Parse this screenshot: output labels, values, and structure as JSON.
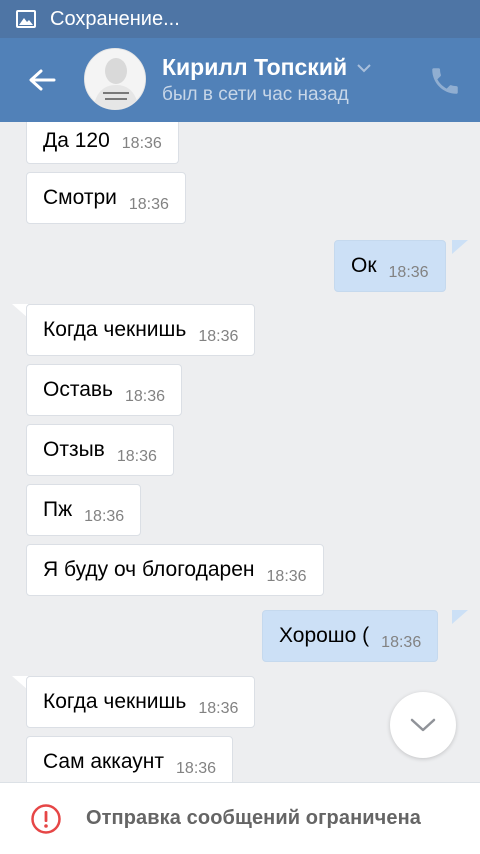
{
  "statusbar": {
    "text": "Сохранение..."
  },
  "header": {
    "name": "Кирилл Топский",
    "status": "был в сети час назад"
  },
  "messages": [
    {
      "text": "Да 120",
      "time": "18:36",
      "dir": "in"
    },
    {
      "text": "Смотри",
      "time": "18:36",
      "dir": "in"
    },
    {
      "text": "Ок",
      "time": "18:36",
      "dir": "out"
    },
    {
      "text": "Когда чекнишь",
      "time": "18:36",
      "dir": "in"
    },
    {
      "text": "Оставь",
      "time": "18:36",
      "dir": "in"
    },
    {
      "text": "Отзыв",
      "time": "18:36",
      "dir": "in"
    },
    {
      "text": "Пж",
      "time": "18:36",
      "dir": "in"
    },
    {
      "text": "Я буду оч блогодарен",
      "time": "18:36",
      "dir": "in"
    },
    {
      "text": "Хорошо (",
      "time": "18:36",
      "dir": "out"
    },
    {
      "text": "Когда чекнишь",
      "time": "18:36",
      "dir": "in"
    },
    {
      "text": "Сам аккаунт",
      "time": "18:36",
      "dir": "in"
    }
  ],
  "bottom": {
    "text": "Отправка сообщений ограничена"
  },
  "colors": {
    "header": "#5181b8",
    "statusbar": "#4e75a5",
    "outgoing": "#cce0f6",
    "incoming": "#ffffff",
    "warning": "#e64646"
  }
}
